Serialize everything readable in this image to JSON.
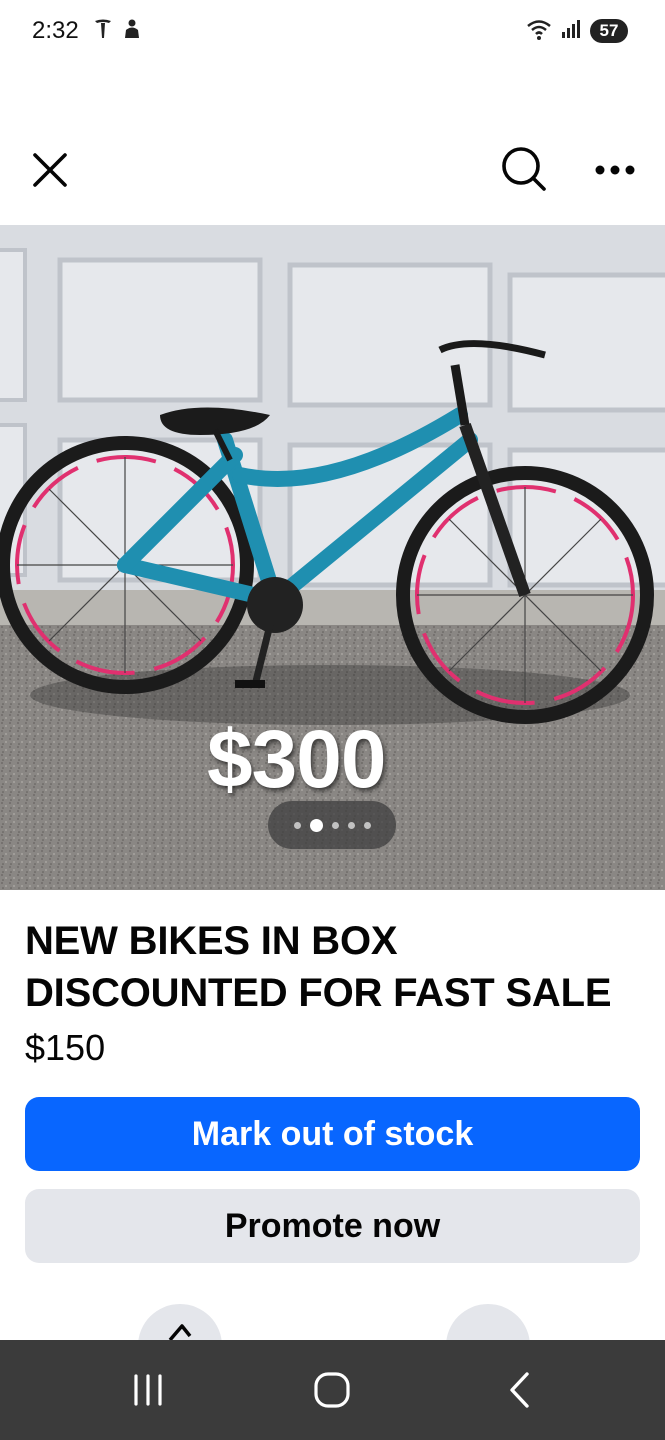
{
  "status_bar": {
    "time": "2:32",
    "battery": "57",
    "icons": [
      "tesla-icon",
      "notification-icon",
      "wifi-icon",
      "signal-icon",
      "battery-icon"
    ]
  },
  "top_bar": {
    "icons": [
      "close-icon",
      "search-icon",
      "more-options-icon"
    ]
  },
  "listing": {
    "photo": {
      "overlay_price": "$300",
      "carousel": {
        "total": 5,
        "active_index": 1
      }
    },
    "title": "NEW BIKES IN BOX DISCOUNTED FOR FAST SALE",
    "price": "$150"
  },
  "actions": {
    "mark_out_of_stock": "Mark out of stock",
    "promote_now": "Promote now"
  },
  "colors": {
    "primary_button": "#0866ff",
    "secondary_button": "#e4e6eb",
    "nav_bar": "#3b3b3b"
  },
  "nav_bar": {
    "icons": [
      "recent-apps-icon",
      "home-icon",
      "back-icon"
    ]
  }
}
